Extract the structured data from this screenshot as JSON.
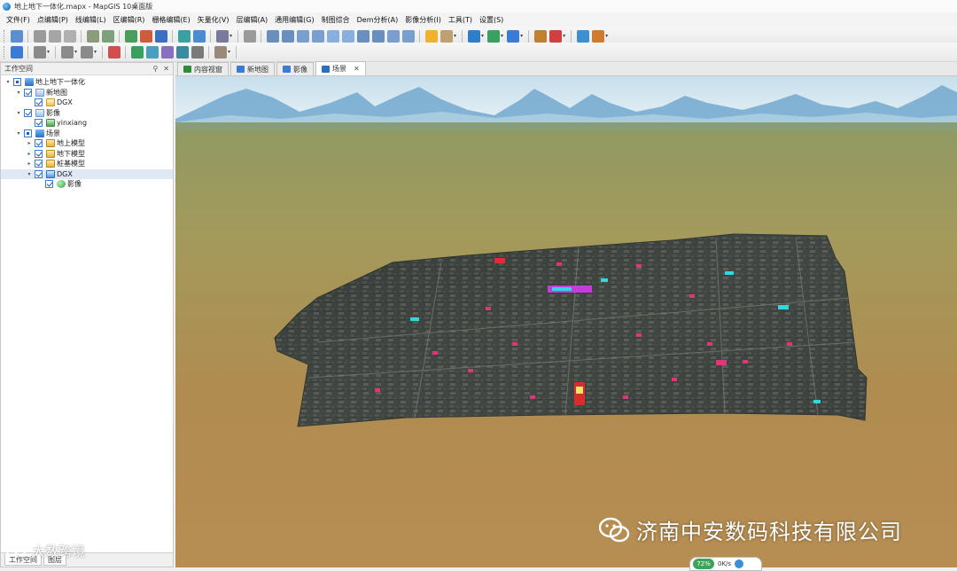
{
  "window": {
    "title": "地上地下一体化.mapx - MapGIS 10桌面版"
  },
  "menubar": {
    "items": [
      "文件(F)",
      "点编辑(P)",
      "线编辑(L)",
      "区编辑(R)",
      "栅格编辑(E)",
      "矢量化(V)",
      "层编辑(A)",
      "通用编辑(G)",
      "制图综合",
      "Dem分析(A)",
      "影像分析(I)",
      "工具(T)",
      "设置(S)"
    ]
  },
  "workspace": {
    "title": "工作空间",
    "pin_symbol": "⚲",
    "close_symbol": "✕",
    "tree": [
      {
        "label": "地上地下一体化",
        "level": 0,
        "twisty": "▾",
        "check": "partial",
        "icon": "scene-icon"
      },
      {
        "label": "新地图",
        "level": 1,
        "twisty": "▾",
        "check": "checked",
        "icon": "map-icon"
      },
      {
        "label": "DGX",
        "level": 2,
        "twisty": "",
        "check": "checked",
        "icon": "layer-icon"
      },
      {
        "label": "影像",
        "level": 1,
        "twisty": "▾",
        "check": "checked",
        "icon": "map-icon"
      },
      {
        "label": "yinxiang",
        "level": 2,
        "twisty": "",
        "check": "checked",
        "icon": "image-icon"
      },
      {
        "label": "场景",
        "level": 1,
        "twisty": "▾",
        "check": "partial",
        "icon": "scene-icon"
      },
      {
        "label": "地上模型",
        "level": 2,
        "twisty": "▸",
        "check": "checked",
        "icon": "folder-icon"
      },
      {
        "label": "地下模型",
        "level": 2,
        "twisty": "▸",
        "check": "checked",
        "icon": "folder-icon"
      },
      {
        "label": "桩基模型",
        "level": 2,
        "twisty": "▸",
        "check": "checked",
        "icon": "folder-icon"
      },
      {
        "label": "DGX",
        "level": 2,
        "twisty": "▾",
        "check": "checked",
        "icon": "dgx-icon",
        "selected": true
      },
      {
        "label": "影像",
        "level": 3,
        "twisty": "",
        "check": "checked",
        "icon": "globe-icon"
      }
    ],
    "bottom_tabs": [
      "工作空间",
      "图层"
    ]
  },
  "doc_tabs": [
    {
      "label": "内容视窗",
      "active": false,
      "icon_color": "#2f8a3a"
    },
    {
      "label": "新地图",
      "active": false,
      "icon_color": "#3a7bd5"
    },
    {
      "label": "影像",
      "active": false,
      "icon_color": "#3a7bd5"
    },
    {
      "label": "场景",
      "active": true,
      "icon_color": "#2a6fc1",
      "close": "✕"
    }
  ],
  "overlay": {
    "watermark_text": "济南中安数码科技有限公司",
    "brand_text": "大数跨境",
    "status_value": "72%",
    "status_label": "0K/s"
  },
  "colors": {
    "sky_top": "#c9e1ef",
    "sky_horizon": "#e7f0f2",
    "mountain": "#6fa8cf",
    "ground_far": "#9a9e62",
    "ground_near": "#b08a4e",
    "city_base": "#3b3f3c",
    "accent_blue": "#3a7bd5"
  }
}
